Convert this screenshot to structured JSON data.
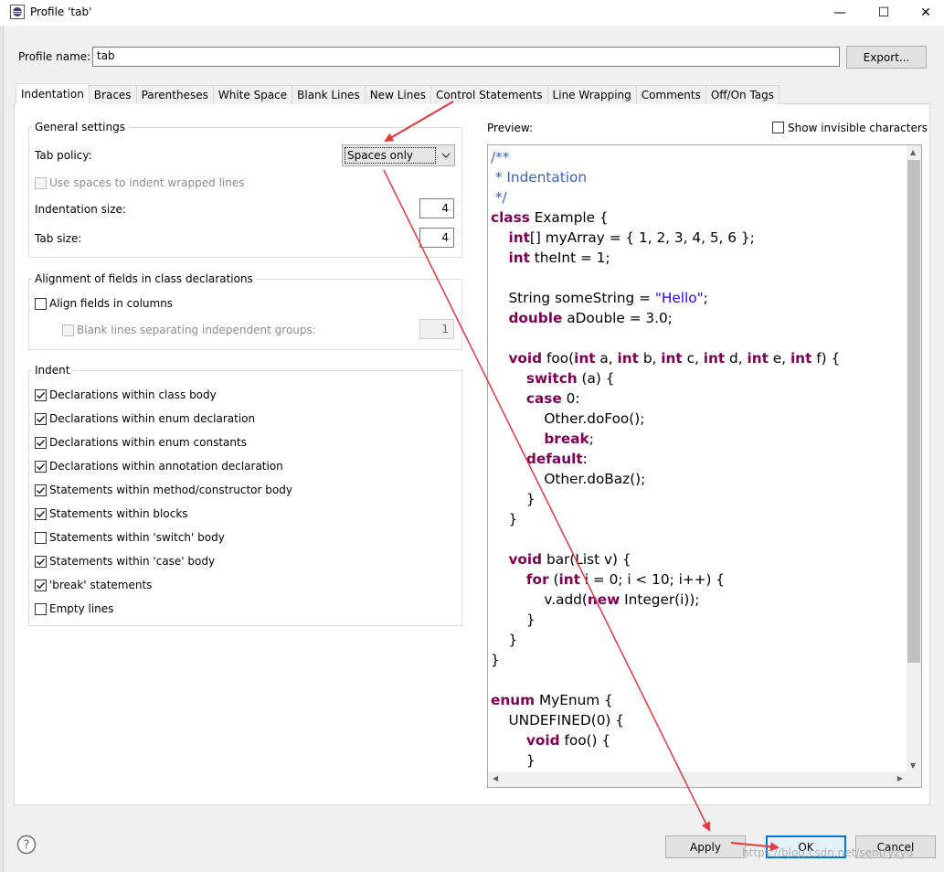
{
  "window": {
    "title": "Profile 'tab'",
    "controls": {
      "minimize": "—",
      "maximize": "☐",
      "close": "✕"
    }
  },
  "profile": {
    "label": "Profile name:",
    "value": "tab",
    "export_label": "Export..."
  },
  "tabs": [
    {
      "label": "Indentation",
      "active": true
    },
    {
      "label": "Braces"
    },
    {
      "label": "Parentheses"
    },
    {
      "label": "White Space"
    },
    {
      "label": "Blank Lines"
    },
    {
      "label": "New Lines"
    },
    {
      "label": "Control Statements"
    },
    {
      "label": "Line Wrapping"
    },
    {
      "label": "Comments"
    },
    {
      "label": "Off/On Tags"
    }
  ],
  "general": {
    "title": "General settings",
    "tab_policy_label": "Tab policy:",
    "tab_policy_value": "Spaces only",
    "use_spaces_label": "Use spaces to indent wrapped lines",
    "indent_size_label": "Indentation size:",
    "indent_size_value": "4",
    "tab_size_label": "Tab size:",
    "tab_size_value": "4"
  },
  "alignment": {
    "title": "Alignment of fields in class declarations",
    "align_label": "Align fields in columns",
    "blank_lines_label": "Blank lines separating independent groups:",
    "blank_lines_value": "1"
  },
  "indent": {
    "title": "Indent",
    "items": [
      {
        "label": "Declarations within class body",
        "checked": true
      },
      {
        "label": "Declarations within enum declaration",
        "checked": true
      },
      {
        "label": "Declarations within enum constants",
        "checked": true
      },
      {
        "label": "Declarations within annotation declaration",
        "checked": true
      },
      {
        "label": "Statements within method/constructor body",
        "checked": true
      },
      {
        "label": "Statements within blocks",
        "checked": true
      },
      {
        "label": "Statements within 'switch' body",
        "checked": false
      },
      {
        "label": "Statements within 'case' body",
        "checked": true
      },
      {
        "label": "'break' statements",
        "checked": true
      },
      {
        "label": "Empty lines",
        "checked": false
      }
    ]
  },
  "preview": {
    "label": "Preview:",
    "show_invisible_label": "Show invisible characters",
    "code_lines": [
      [
        [
          "cm",
          "/**"
        ]
      ],
      [
        [
          "cm",
          " * Indentation"
        ]
      ],
      [
        [
          "cm",
          " */"
        ]
      ],
      [
        [
          "kw",
          "class"
        ],
        [
          "t",
          " Example {"
        ]
      ],
      [
        [
          "t",
          "    "
        ],
        [
          "kw",
          "int"
        ],
        [
          "t",
          "[] myArray = { 1, 2, 3, 4, 5, 6 };"
        ]
      ],
      [
        [
          "t",
          "    "
        ],
        [
          "kw",
          "int"
        ],
        [
          "t",
          " theInt = 1;"
        ]
      ],
      [
        [
          "t",
          ""
        ]
      ],
      [
        [
          "t",
          "    String someString = "
        ],
        [
          "str",
          "\"Hello\""
        ],
        [
          "t",
          ";"
        ]
      ],
      [
        [
          "t",
          "    "
        ],
        [
          "kw",
          "double"
        ],
        [
          "t",
          " aDouble = 3.0;"
        ]
      ],
      [
        [
          "t",
          ""
        ]
      ],
      [
        [
          "t",
          "    "
        ],
        [
          "kw",
          "void"
        ],
        [
          "t",
          " foo("
        ],
        [
          "kw",
          "int"
        ],
        [
          "t",
          " a, "
        ],
        [
          "kw",
          "int"
        ],
        [
          "t",
          " b, "
        ],
        [
          "kw",
          "int"
        ],
        [
          "t",
          " c, "
        ],
        [
          "kw",
          "int"
        ],
        [
          "t",
          " d, "
        ],
        [
          "kw",
          "int"
        ],
        [
          "t",
          " e, "
        ],
        [
          "kw",
          "int"
        ],
        [
          "t",
          " f) {"
        ]
      ],
      [
        [
          "t",
          "        "
        ],
        [
          "kw",
          "switch"
        ],
        [
          "t",
          " (a) {"
        ]
      ],
      [
        [
          "t",
          "        "
        ],
        [
          "kw",
          "case"
        ],
        [
          "t",
          " 0:"
        ]
      ],
      [
        [
          "t",
          "            Other.doFoo();"
        ]
      ],
      [
        [
          "t",
          "            "
        ],
        [
          "kw",
          "break"
        ],
        [
          "t",
          ";"
        ]
      ],
      [
        [
          "t",
          "        "
        ],
        [
          "kw",
          "default"
        ],
        [
          "t",
          ":"
        ]
      ],
      [
        [
          "t",
          "            Other.doBaz();"
        ]
      ],
      [
        [
          "t",
          "        }"
        ]
      ],
      [
        [
          "t",
          "    }"
        ]
      ],
      [
        [
          "t",
          ""
        ]
      ],
      [
        [
          "t",
          "    "
        ],
        [
          "kw",
          "void"
        ],
        [
          "t",
          " bar(List v) {"
        ]
      ],
      [
        [
          "t",
          "        "
        ],
        [
          "kw",
          "for"
        ],
        [
          "t",
          " ("
        ],
        [
          "kw",
          "int"
        ],
        [
          "t",
          " i = 0; i < 10; i++) {"
        ]
      ],
      [
        [
          "t",
          "            v.add("
        ],
        [
          "kw",
          "new"
        ],
        [
          "t",
          " Integer(i));"
        ]
      ],
      [
        [
          "t",
          "        }"
        ]
      ],
      [
        [
          "t",
          "    }"
        ]
      ],
      [
        [
          "t",
          "}"
        ]
      ],
      [
        [
          "t",
          ""
        ]
      ],
      [
        [
          "kw",
          "enum"
        ],
        [
          "t",
          " MyEnum {"
        ]
      ],
      [
        [
          "t",
          "    UNDEFINED(0) {"
        ]
      ],
      [
        [
          "t",
          "        "
        ],
        [
          "kw",
          "void"
        ],
        [
          "t",
          " foo() {"
        ]
      ],
      [
        [
          "t",
          "        }"
        ]
      ]
    ]
  },
  "buttons": {
    "apply": "Apply",
    "ok": "OK",
    "cancel": "Cancel"
  },
  "watermark": "https://blog.csdn.net/sentryzyu",
  "colors": {
    "keyword": "#7f0055",
    "comment": "#3f5fbf",
    "string": "#2a00ff",
    "annotation_arrow": "#e8363a",
    "ok_border": "#0078d7"
  }
}
